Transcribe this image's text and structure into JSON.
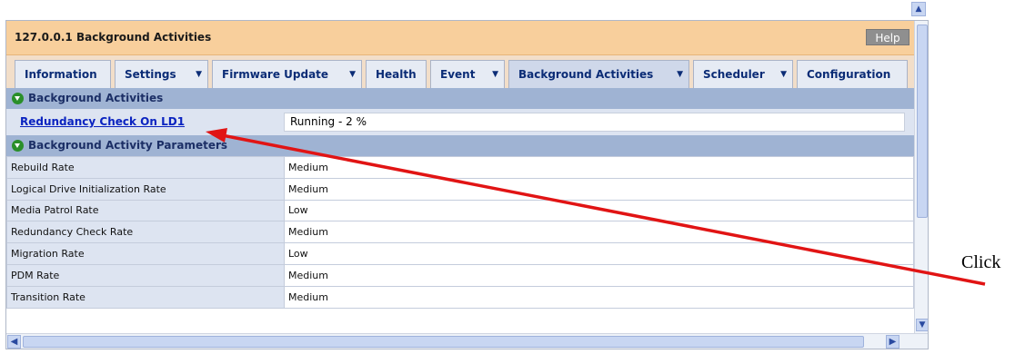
{
  "window": {
    "title": "127.0.0.1 Background Activities",
    "help_label": "Help"
  },
  "tabs": [
    {
      "label": "Information",
      "has_menu": false,
      "active": false
    },
    {
      "label": "Settings",
      "has_menu": true,
      "active": false
    },
    {
      "label": "Firmware Update",
      "has_menu": true,
      "active": false
    },
    {
      "label": "Health",
      "has_menu": false,
      "active": false
    },
    {
      "label": "Event",
      "has_menu": true,
      "active": false
    },
    {
      "label": "Background Activities",
      "has_menu": true,
      "active": true
    },
    {
      "label": "Scheduler",
      "has_menu": true,
      "active": false
    },
    {
      "label": "Configuration",
      "has_menu": false,
      "active": false
    }
  ],
  "background_activities": {
    "header": "Background Activities",
    "item": {
      "link": "Redundancy Check On LD1",
      "status": "Running - 2 %"
    }
  },
  "parameters": {
    "header": "Background Activity Parameters",
    "rows": [
      {
        "name": "Rebuild Rate",
        "value": "Medium"
      },
      {
        "name": "Logical Drive Initialization Rate",
        "value": "Medium"
      },
      {
        "name": "Media Patrol Rate",
        "value": "Low"
      },
      {
        "name": "Redundancy Check Rate",
        "value": "Medium"
      },
      {
        "name": "Migration Rate",
        "value": "Low"
      },
      {
        "name": "PDM Rate",
        "value": "Medium"
      },
      {
        "name": "Transition Rate",
        "value": "Medium"
      }
    ]
  },
  "annotation": {
    "text": "Click",
    "color": "#e11414"
  }
}
